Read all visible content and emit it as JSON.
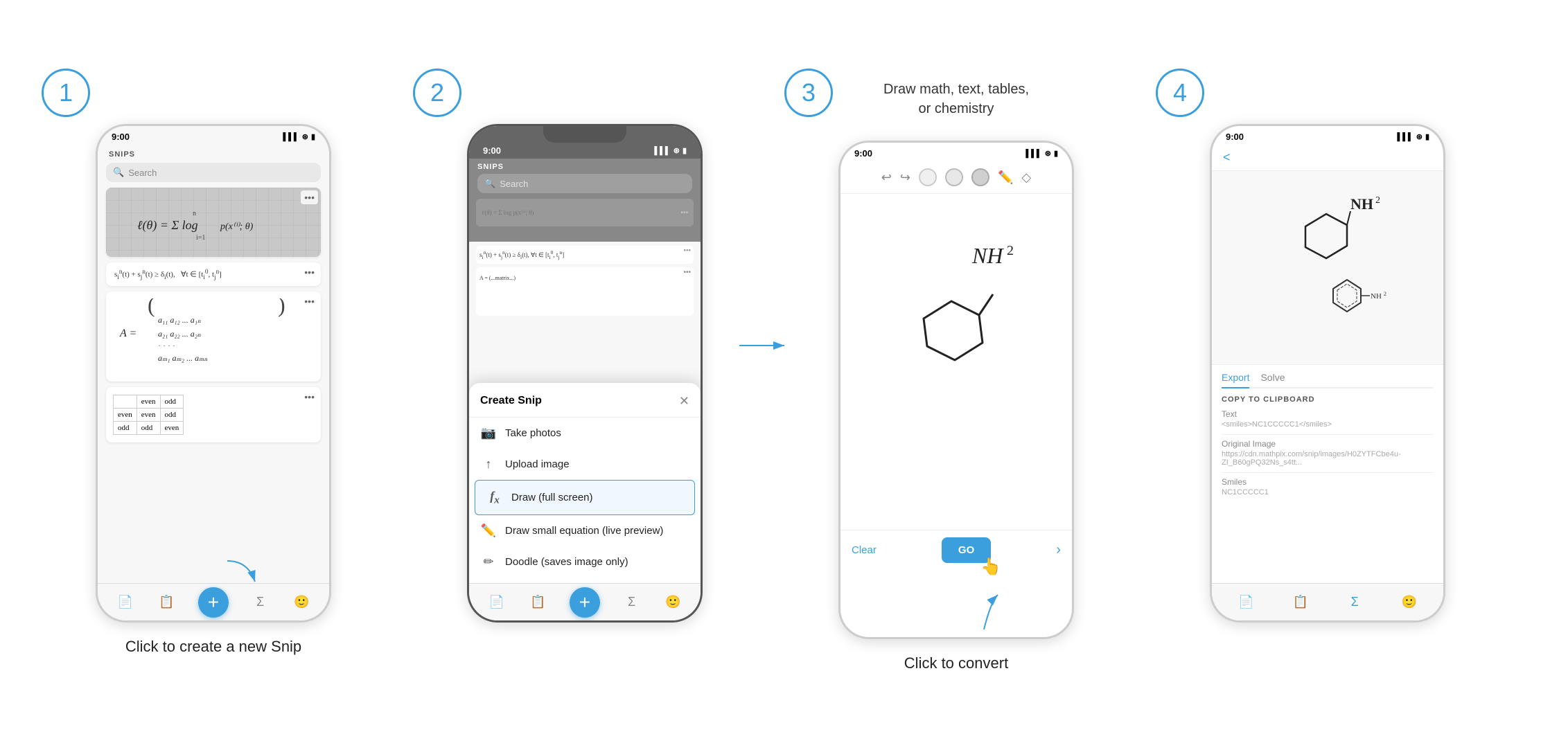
{
  "steps": [
    {
      "number": "1",
      "label": "Click to create a new Snip",
      "annotation_top": null
    },
    {
      "number": "2",
      "label": null,
      "annotation_top": null,
      "modal_title": "Create Snip",
      "modal_items": [
        {
          "icon": "📷",
          "text": "Take photos"
        },
        {
          "icon": "↑",
          "text": "Upload image"
        },
        {
          "icon": "fx",
          "text": "Draw (full screen)",
          "highlighted": true
        },
        {
          "icon": "✏️",
          "text": "Draw small equation (live preview)"
        },
        {
          "icon": "✏",
          "text": "Doodle (saves image only)"
        }
      ]
    },
    {
      "number": "3",
      "label": "Click to convert",
      "annotation_top": "Draw math, text, tables,\nor chemistry"
    },
    {
      "number": "4",
      "label": null,
      "annotation_top": null
    }
  ],
  "phone_time": "9:00",
  "snips_title": "SNIPS",
  "search_placeholder": "Search",
  "export_label": "Export",
  "solve_label": "Solve",
  "copy_clipboard_label": "COPY TO CLIPBOARD",
  "text_label": "Text",
  "text_value": "<smiles>NC1CCCCC1</smiles>",
  "original_image_label": "Original Image",
  "original_image_value": "https://cdn.mathpix.com/snip/images/H0ZYTFCbe4u-ZI_B60gPQ32Ns_s4tt...",
  "smiles_label": "Smiles",
  "smiles_value": "NC1CCCCC1",
  "clear_btn": "Clear",
  "go_btn": "GO",
  "draw_math_text": "Draw math, text, tables,\nor chemistry"
}
